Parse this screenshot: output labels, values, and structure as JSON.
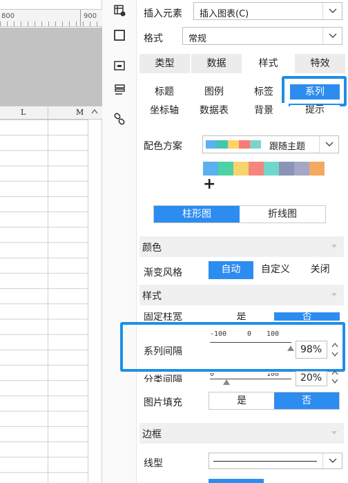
{
  "sheet": {
    "ruler": {
      "left_label": "800",
      "right_label": "900"
    },
    "columns": [
      "L",
      "M"
    ]
  },
  "panel": {
    "insert": {
      "label": "插入元素",
      "value": "插入图表(C)"
    },
    "format": {
      "label": "格式",
      "value": "常规"
    },
    "tabs": [
      {
        "label": "类型",
        "active": false
      },
      {
        "label": "数据",
        "active": false
      },
      {
        "label": "样式",
        "active": true
      },
      {
        "label": "特效",
        "active": false
      }
    ],
    "subtabs_row1": [
      {
        "label": "标题",
        "active": false
      },
      {
        "label": "图例",
        "active": false
      },
      {
        "label": "标签",
        "active": false
      },
      {
        "label": "系列",
        "active": true
      }
    ],
    "subtabs_row2": [
      {
        "label": "坐标轴",
        "active": false
      },
      {
        "label": "数据表",
        "active": false
      },
      {
        "label": "背景",
        "active": false
      },
      {
        "label": "提示",
        "active": false
      }
    ],
    "color_scheme": {
      "label": "配色方案",
      "value": "跟随主题",
      "preview_colors": [
        "#5ab1ef",
        "#43c6ac",
        "#ffd266",
        "#f87b74",
        "#7ed3c9"
      ],
      "palette": [
        "#5ab1ef",
        "#4cd3a3",
        "#f7d46e",
        "#f5857d",
        "#73d6cd",
        "#8b93b6",
        "#a4a7c5",
        "#f5a85f"
      ],
      "add_symbol": "+"
    },
    "chart_kind": {
      "options": [
        "柱形图",
        "折线图"
      ],
      "selected": 0
    },
    "color_section": "颜色",
    "gradient": {
      "label": "渐变风格",
      "options": [
        "自动",
        "自定义",
        "关闭"
      ],
      "selected": 0
    },
    "style_section": "样式",
    "fixed_width": {
      "label": "固定柱宽",
      "options": [
        "是",
        "否"
      ],
      "selected": 1
    },
    "series_gap": {
      "label": "系列间隔",
      "ticks": [
        "-100",
        "0",
        "100"
      ],
      "value": "98%",
      "level": 98
    },
    "category_gap": {
      "label": "分类间隔",
      "ticks": [
        "0",
        "100"
      ],
      "value": "20%",
      "level": 20
    },
    "image_fill": {
      "label": "图片填充",
      "options": [
        "是",
        "否"
      ],
      "selected": 1
    },
    "border_section": "边框",
    "line_type": {
      "label": "线型"
    }
  },
  "colors": {
    "accent": "#2d8cf0",
    "highlight": "#1e8fe6"
  }
}
